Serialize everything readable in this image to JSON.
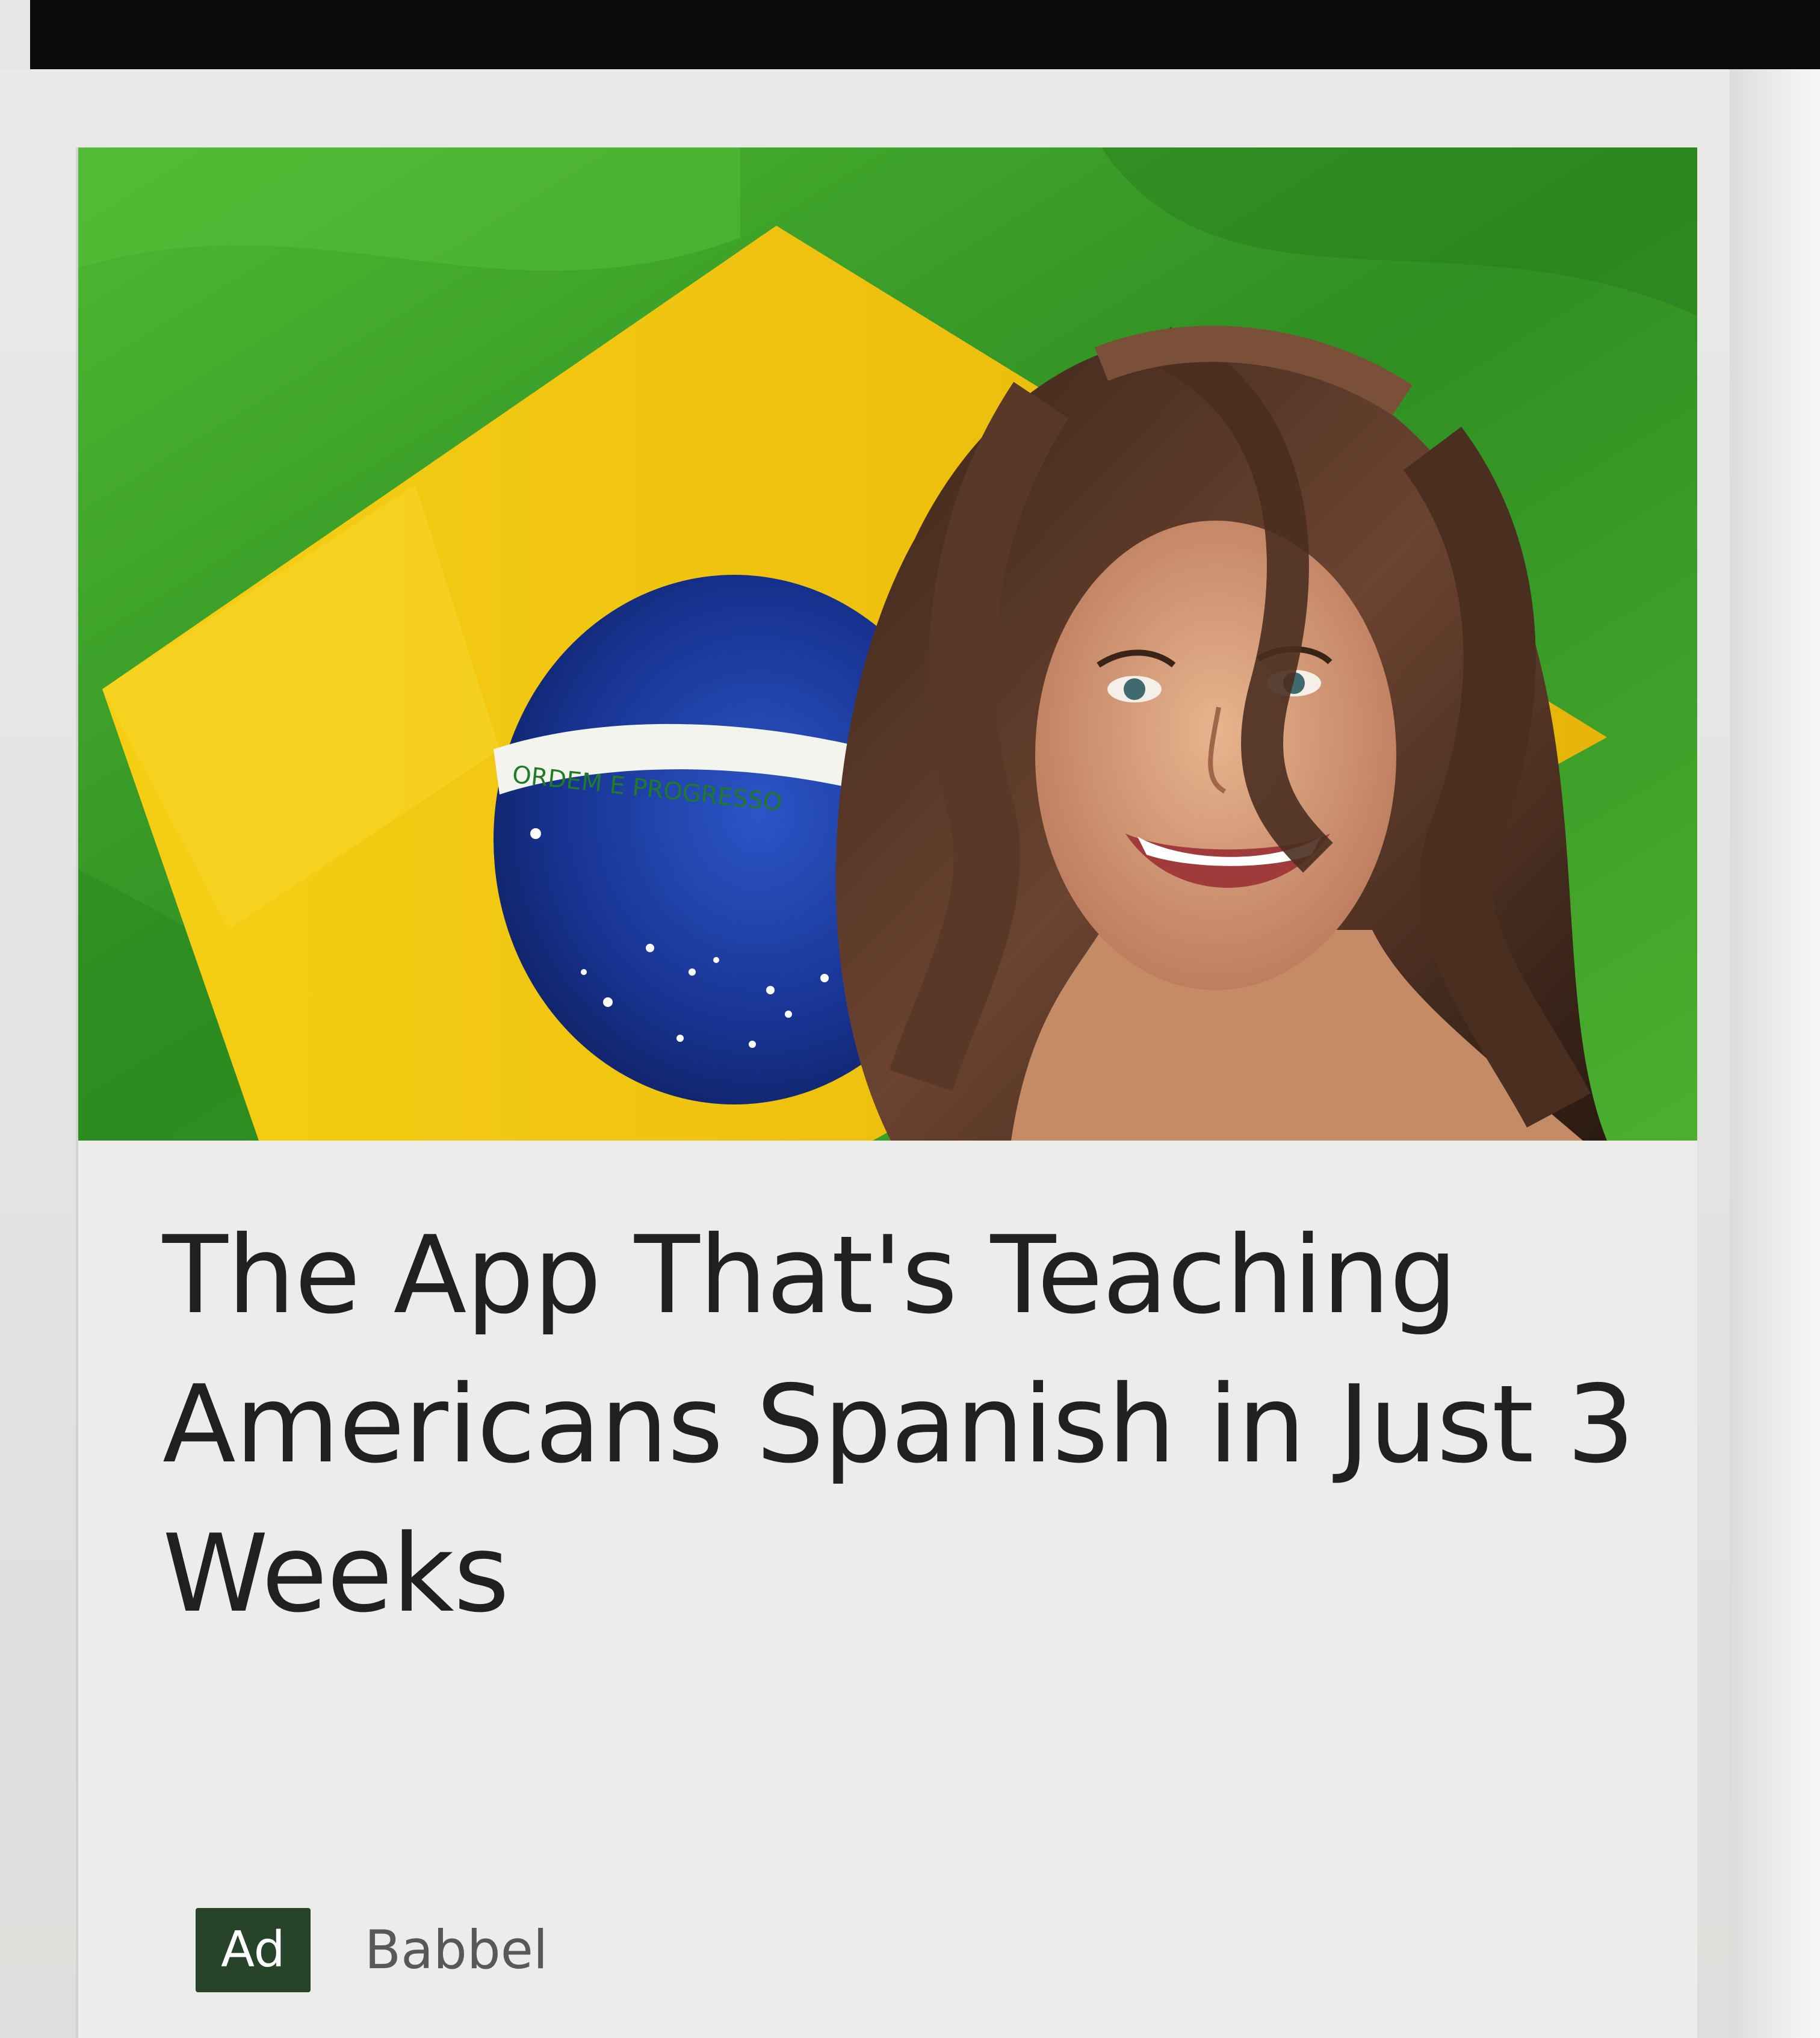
{
  "ad": {
    "image_alt": "Smiling woman with long brown hair in front of the Brazilian flag",
    "flag_motto": "ORDEM E PROGRESSO",
    "headline": "The App That's Teaching Americans Spanish in Just 3 Weeks",
    "badge": "Ad",
    "advertiser": "Babbel"
  },
  "colors": {
    "badge_bg": "#27442b",
    "flag_green": "#3fa12a",
    "flag_yellow": "#f2c70f",
    "flag_blue": "#1b3aa0"
  }
}
